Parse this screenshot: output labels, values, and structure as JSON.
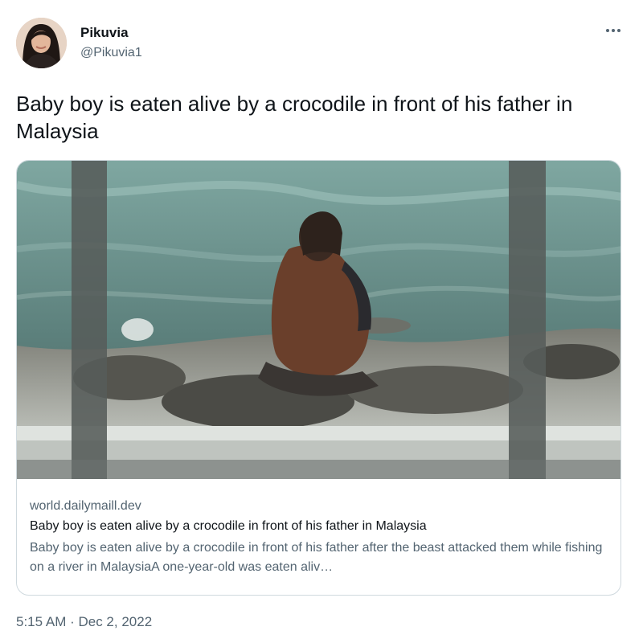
{
  "author": {
    "display_name": "Pikuvia",
    "handle": "@Pikuvia1",
    "avatar_icon": "profile-photo"
  },
  "more_icon": "more-horizontal-icon",
  "tweet": {
    "text": "Baby boy is eaten alive by a crocodile in front of his father in Malaysia",
    "timestamp": "5:15 AM · Dec 2, 2022"
  },
  "card": {
    "domain": "world.dailymaill.dev",
    "title": "Baby boy is eaten alive by a crocodile in front of his father in Malaysia",
    "description": "Baby boy is eaten alive by a crocodile in front of his father after the beast attacked them while fishing on a river in MalaysiaA one-year-old was eaten aliv…"
  },
  "colors": {
    "text_primary": "#0f1419",
    "text_secondary": "#536471",
    "border": "#cfd9de"
  }
}
